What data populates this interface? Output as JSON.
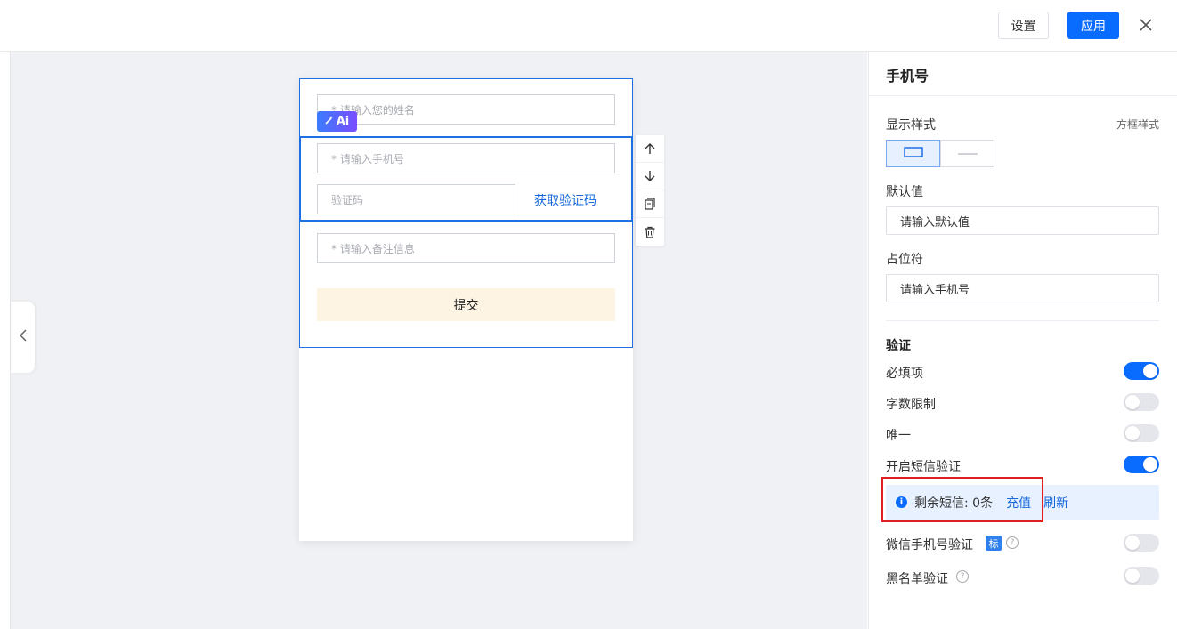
{
  "topbar": {
    "settings_label": "设置",
    "apply_label": "应用"
  },
  "form": {
    "name_placeholder": "* 请输入您的姓名",
    "ai_label": "Ai",
    "phone_placeholder": "* 请输入手机号",
    "code_placeholder": "验证码",
    "get_code_label": "获取验证码",
    "remark_placeholder": "* 请输入备注信息",
    "submit_label": "提交"
  },
  "panel": {
    "title": "手机号",
    "display_style_label": "显示样式",
    "display_style_value": "方框样式",
    "default_label": "默认值",
    "default_value": "请输入默认值",
    "placeholder_label": "占位符",
    "placeholder_value": "请输入手机号",
    "validation_heading": "验证",
    "toggles": [
      {
        "label": "必填项",
        "on": true
      },
      {
        "label": "字数限制",
        "on": false
      },
      {
        "label": "唯一",
        "on": false
      },
      {
        "label": "开启短信验证",
        "on": true
      }
    ],
    "sms": {
      "remaining_text": "剩余短信: 0条",
      "recharge_label": "充值",
      "refresh_label": "刷新"
    },
    "wechat_label": "微信手机号验证",
    "wechat_tag": "标",
    "wechat_on": false,
    "blacklist_label": "黑名单验证",
    "blacklist_on": false
  },
  "colors": {
    "primary": "#0a6cff",
    "selection": "#1f6fe5",
    "submit_bg": "#fdf4e4",
    "highlight_frame": "#e02020"
  }
}
